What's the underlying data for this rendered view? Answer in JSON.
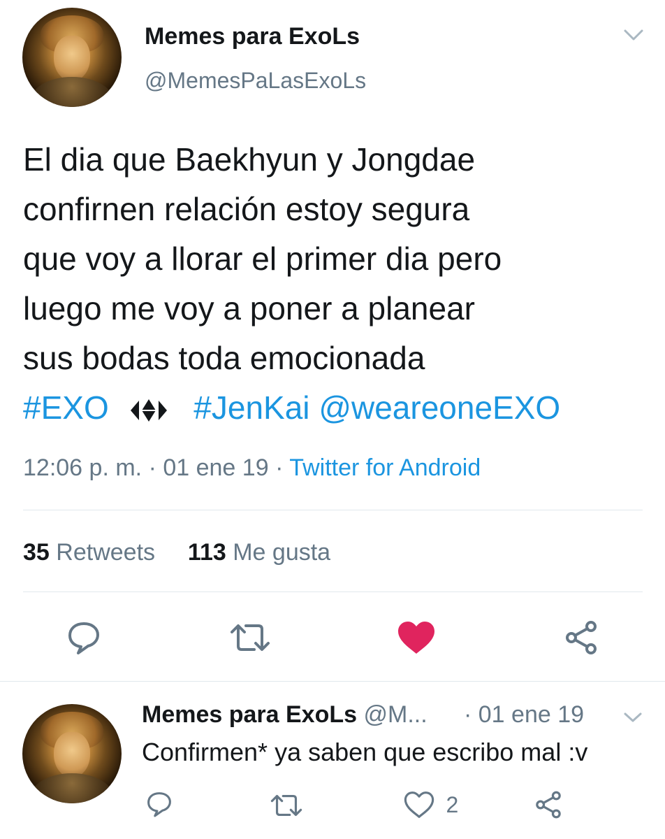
{
  "main_tweet": {
    "display_name": "Memes para ExoLs",
    "handle": "@MemesPaLasExoLs",
    "text_lines": [
      "El dia que Baekhyun y Jongdae",
      "confirnen relación estoy segura",
      "que voy a llorar el primer dia pero",
      "luego me voy a poner a planear",
      "sus bodas toda emocionada"
    ],
    "hashtag_exo": "#EXO",
    "hashtag_jenkai": "#JenKai",
    "mention": "@weareoneEXO",
    "time": "12:06 p. m.",
    "date": "01 ene 19",
    "separator": "·",
    "source": "Twitter for Android",
    "retweets_count": "35",
    "retweets_label": "Retweets",
    "likes_count": "113",
    "likes_label": "Me gusta",
    "liked": true
  },
  "reply_tweet": {
    "display_name": "Memes para ExoLs",
    "handle_truncated": "@M...",
    "date": "· 01 ene 19",
    "text": "Confirmen* ya saben que escribo mal :v",
    "likes_count": "2"
  },
  "colors": {
    "link": "#1b95e0",
    "secondary_text": "#657786",
    "like_red": "#e0245e",
    "divider": "#e1e8ed"
  },
  "icons": {
    "reply": "reply-icon",
    "retweet": "retweet-icon",
    "like": "heart-icon",
    "share": "share-icon",
    "menu": "chevron-down-icon",
    "exo_logo": "exo-logo-icon"
  }
}
